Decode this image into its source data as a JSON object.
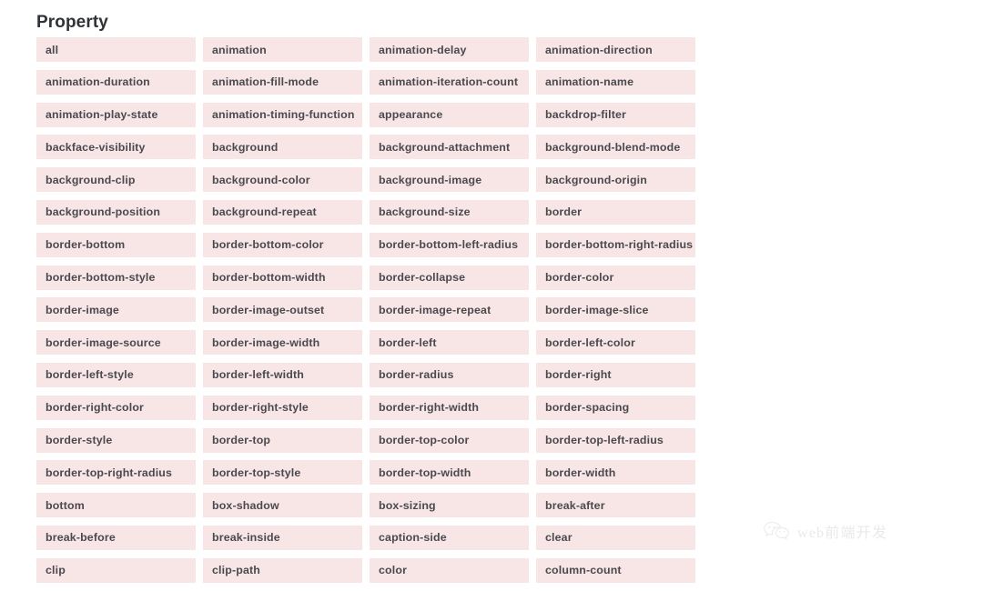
{
  "page": {
    "background_color": "#ffffff",
    "cell_color": "#f8e5e6",
    "text_color": "#4a4a4e",
    "title_color": "#2f3236"
  },
  "table": {
    "title": "Property",
    "column_count": 4,
    "rows": [
      [
        "all",
        "animation",
        "animation-delay",
        "animation-direction"
      ],
      [
        "animation-duration",
        "animation-fill-mode",
        "animation-iteration-count",
        "animation-name"
      ],
      [
        "animation-play-state",
        "animation-timing-function",
        "appearance",
        "backdrop-filter"
      ],
      [
        "backface-visibility",
        "background",
        "background-attachment",
        "background-blend-mode"
      ],
      [
        "background-clip",
        "background-color",
        "background-image",
        "background-origin"
      ],
      [
        "background-position",
        "background-repeat",
        "background-size",
        "border"
      ],
      [
        "border-bottom",
        "border-bottom-color",
        "border-bottom-left-radius",
        "border-bottom-right-radius"
      ],
      [
        "border-bottom-style",
        "border-bottom-width",
        "border-collapse",
        "border-color"
      ],
      [
        "border-image",
        "border-image-outset",
        "border-image-repeat",
        "border-image-slice"
      ],
      [
        "border-image-source",
        "border-image-width",
        "border-left",
        "border-left-color"
      ],
      [
        "border-left-style",
        "border-left-width",
        "border-radius",
        "border-right"
      ],
      [
        "border-right-color",
        "border-right-style",
        "border-right-width",
        "border-spacing"
      ],
      [
        "border-style",
        "border-top",
        "border-top-color",
        "border-top-left-radius"
      ],
      [
        "border-top-right-radius",
        "border-top-style",
        "border-top-width",
        "border-width"
      ],
      [
        "bottom",
        "box-shadow",
        "box-sizing",
        "break-after"
      ],
      [
        "break-before",
        "break-inside",
        "caption-side",
        "clear"
      ],
      [
        "clip",
        "clip-path",
        "color",
        "column-count"
      ]
    ]
  },
  "watermark": {
    "text": "web前端开发",
    "logo_icon": "wechat-bubbles-icon",
    "color": "#d8d8d8"
  }
}
